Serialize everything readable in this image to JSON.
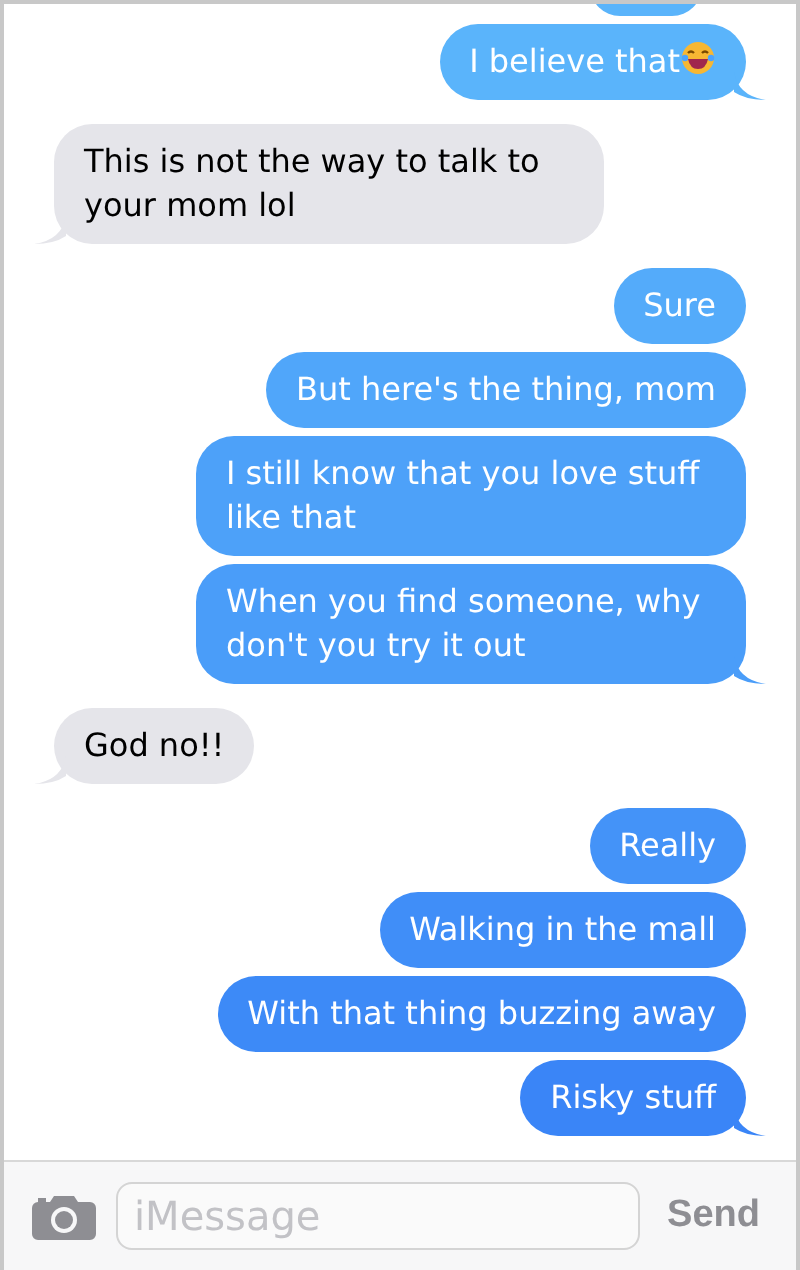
{
  "messages": [
    {
      "kind": "sent",
      "text": "I believe that",
      "emoji": true,
      "tail": true
    },
    {
      "kind": "received",
      "text": "This is not the way to talk to your mom lol",
      "tail": true
    },
    {
      "kind": "sent",
      "text": "Sure",
      "tail": false
    },
    {
      "kind": "sent",
      "text": "But here's the thing, mom",
      "tail": false
    },
    {
      "kind": "sent",
      "text": "I still know that you love stuff like that",
      "tail": false
    },
    {
      "kind": "sent",
      "text": "When you find someone, why don't you try it out",
      "tail": true
    },
    {
      "kind": "received",
      "text": "God no!!",
      "tail": true
    },
    {
      "kind": "sent",
      "text": "Really",
      "tail": false
    },
    {
      "kind": "sent",
      "text": "Walking in the mall",
      "tail": false
    },
    {
      "kind": "sent",
      "text": "With that thing buzzing away",
      "tail": false
    },
    {
      "kind": "sent",
      "text": "Risky stuff",
      "tail": true
    }
  ],
  "composer": {
    "placeholder": "iMessage",
    "send_label": "Send"
  }
}
